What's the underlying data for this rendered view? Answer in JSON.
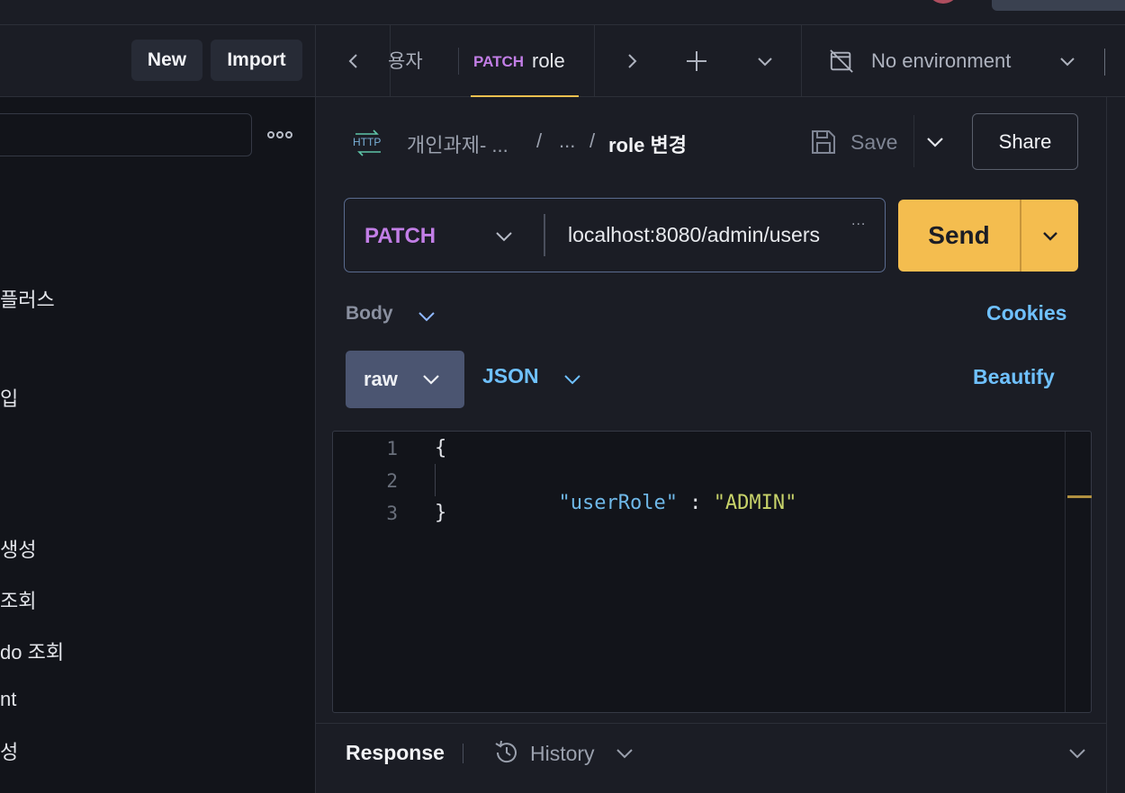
{
  "sidebar": {
    "new_label": "New",
    "import_label": "Import",
    "more_icon": "more-dots-icon",
    "items": [
      {
        "label": "플러스"
      },
      {
        "label": "입"
      },
      {
        "label": "생성"
      },
      {
        "label": "조회"
      },
      {
        "label": "do 조회"
      },
      {
        "label": "nt"
      },
      {
        "label": "성"
      }
    ]
  },
  "tabs": {
    "partial_tab_label": "용자",
    "active_tab": {
      "method": "PATCH",
      "name": "role"
    },
    "environment": "No environment"
  },
  "request": {
    "breadcrumb": [
      "개인과제- ...",
      "...",
      "role 변경"
    ],
    "save_label": "Save",
    "share_label": "Share",
    "method": "PATCH",
    "url": "localhost:8080/admin/users",
    "url_overflow": "...",
    "send_label": "Send"
  },
  "body": {
    "label": "Body",
    "cookies_label": "Cookies",
    "mode_label": "raw",
    "format_label": "JSON",
    "beautify_label": "Beautify",
    "lines": [
      {
        "num": "1",
        "text": "{"
      },
      {
        "num": "2",
        "key": "\"userRole\"",
        "colon": " : ",
        "value": "\"ADMIN\""
      },
      {
        "num": "3",
        "text": "}"
      }
    ]
  },
  "response": {
    "label": "Response",
    "history_label": "History"
  },
  "colors": {
    "accent": "#f4bd4f",
    "method_patch": "#c27ee6",
    "link_blue": "#6fc1ff",
    "json_key": "#6fb8e8",
    "json_string": "#c8d36a"
  }
}
